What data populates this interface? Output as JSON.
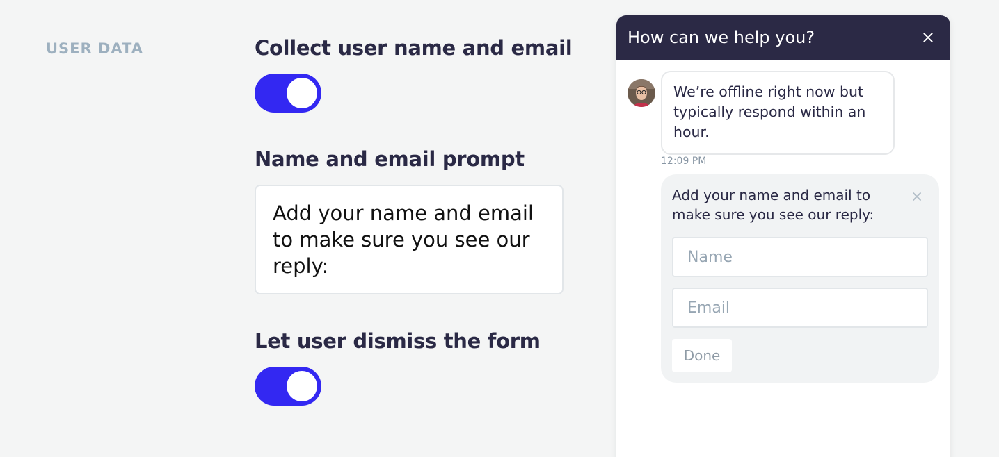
{
  "settings": {
    "section_label": "USER DATA",
    "collect_title": "Collect user name and email",
    "collect_enabled": true,
    "prompt_title": "Name and email prompt",
    "prompt_value": "Add your name and email to make sure you see our reply:",
    "dismiss_title": "Let user dismiss the form",
    "dismiss_enabled": true
  },
  "colors": {
    "toggle_on": "#3328f2",
    "header_bg": "#2b2945",
    "section_label": "#9db0bf"
  },
  "chat": {
    "title": "How can we help you?",
    "message": "We’re offline right now but typically respond within an hour.",
    "timestamp": "12:09 PM",
    "form": {
      "text": "Add your name and email to make sure you see our reply:",
      "name_placeholder": "Name",
      "email_placeholder": "Email",
      "done_label": "Done"
    }
  }
}
